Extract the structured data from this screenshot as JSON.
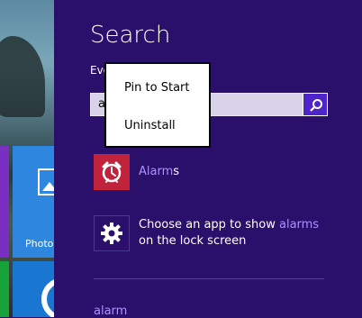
{
  "backdrop": {
    "tile_label": "Photo"
  },
  "search": {
    "title": "Search",
    "scope": "Eve",
    "query": "a",
    "button_icon": "search-icon"
  },
  "results": [
    {
      "icon": "alarm-clock-icon",
      "text_hl": "Alarm",
      "text_rest": "s"
    },
    {
      "icon": "gear-icon",
      "text_before": "Choose an app to show ",
      "text_hl": "alarms",
      "text_after_line2": "on the lock screen"
    }
  ],
  "suggestion": "alarm",
  "context_menu": {
    "items": [
      "Pin to Start",
      "Uninstall"
    ]
  },
  "colors": {
    "pane_bg": "#2a0f6b",
    "highlight": "#b090ff",
    "alarm_tile": "#c0233b",
    "search_button": "#4d25c8"
  }
}
